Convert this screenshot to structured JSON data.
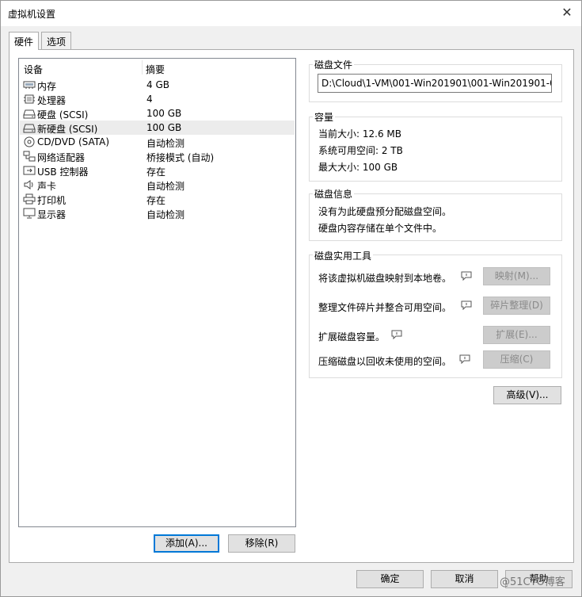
{
  "window": {
    "title": "虚拟机设置",
    "close_glyph": "✕"
  },
  "tabs": [
    {
      "label": "硬件",
      "active": true
    },
    {
      "label": "选项",
      "active": false
    }
  ],
  "device_list": {
    "columns": [
      "设备",
      "摘要"
    ],
    "rows": [
      {
        "name": "内存",
        "summary": "4 GB",
        "icon": "memory-icon"
      },
      {
        "name": "处理器",
        "summary": "4",
        "icon": "processor-icon"
      },
      {
        "name": "硬盘 (SCSI)",
        "summary": "100 GB",
        "icon": "hard-disk-icon"
      },
      {
        "name": "新硬盘 (SCSI)",
        "summary": "100 GB",
        "icon": "hard-disk-icon",
        "selected": true
      },
      {
        "name": "CD/DVD (SATA)",
        "summary": "自动检测",
        "icon": "cd-dvd-icon"
      },
      {
        "name": "网络适配器",
        "summary": "桥接模式 (自动)",
        "icon": "network-adapter-icon"
      },
      {
        "name": "USB 控制器",
        "summary": "存在",
        "icon": "usb-icon"
      },
      {
        "name": "声卡",
        "summary": "自动检测",
        "icon": "speaker-icon"
      },
      {
        "name": "打印机",
        "summary": "存在",
        "icon": "printer-icon"
      },
      {
        "name": "显示器",
        "summary": "自动检测",
        "icon": "monitor-icon"
      }
    ]
  },
  "list_buttons": {
    "add": "添加(A)...",
    "remove": "移除(R)"
  },
  "disk_file": {
    "title": "磁盘文件",
    "path": "D:\\Cloud\\1-VM\\001-Win201901\\001-Win201901-0.v"
  },
  "capacity": {
    "title": "容量",
    "current": "当前大小: 12.6 MB",
    "available": "系统可用空间: 2 TB",
    "max": "最大大小: 100 GB"
  },
  "disk_info": {
    "title": "磁盘信息",
    "line1": "没有为此硬盘预分配磁盘空间。",
    "line2": "硬盘内容存储在单个文件中。"
  },
  "utilities": {
    "title": "磁盘实用工具",
    "items": [
      {
        "text": "将该虚拟机磁盘映射到本地卷。",
        "button": "映射(M)..."
      },
      {
        "text": "整理文件碎片并整合可用空间。",
        "button": "碎片整理(D)"
      },
      {
        "text": "扩展磁盘容量。",
        "button": "扩展(E)..."
      },
      {
        "text": "压缩磁盘以回收未使用的空间。",
        "button": "压缩(C)"
      }
    ]
  },
  "advanced_button": "高级(V)...",
  "footer": {
    "ok": "确定",
    "cancel": "取消",
    "help": "帮助"
  },
  "watermark": "@51CTO博客"
}
